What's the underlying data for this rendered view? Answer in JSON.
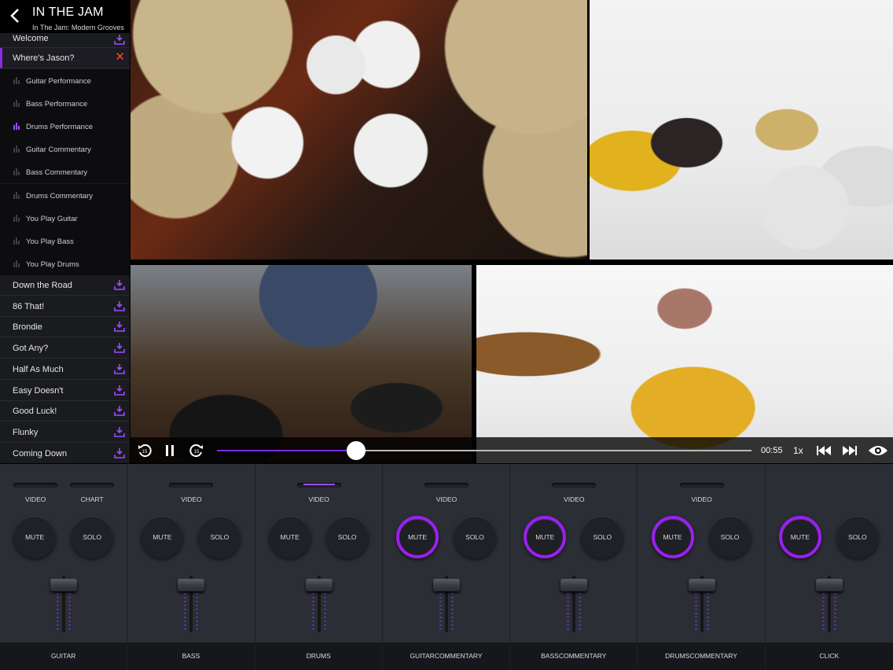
{
  "header": {
    "back_icon": "chevron-left-icon",
    "title": "IN THE JAM",
    "subtitle": "In The Jam: Modern Grooves"
  },
  "sidebar": {
    "top_item": {
      "label": "Welcome",
      "icon": "download-icon"
    },
    "active_song": {
      "label": "Where's Jason?",
      "close_icon": "close-icon"
    },
    "sub_items": [
      {
        "label": "Guitar Performance",
        "playing": false
      },
      {
        "label": "Bass Performance",
        "playing": false
      },
      {
        "label": "Drums Performance",
        "playing": true
      },
      {
        "label": "Guitar Commentary",
        "playing": false
      },
      {
        "label": "Bass Commentary",
        "playing": false
      },
      {
        "label": "Drums Commentary",
        "playing": false
      },
      {
        "label": "You Play Guitar",
        "playing": false
      },
      {
        "label": "You Play Bass",
        "playing": false
      },
      {
        "label": "You Play Drums",
        "playing": false
      }
    ],
    "songs": [
      {
        "label": "Down the Road"
      },
      {
        "label": "86 That!"
      },
      {
        "label": "Brondie"
      },
      {
        "label": "Got Any?"
      },
      {
        "label": "Half As Much"
      },
      {
        "label": "Easy Doesn't"
      },
      {
        "label": "Good Luck!"
      },
      {
        "label": "Flunky"
      },
      {
        "label": "Coming Down"
      }
    ],
    "download_icon": "download-icon",
    "accent": "#8a2be2"
  },
  "transport": {
    "rewind_icon": "rewind-15-icon",
    "pause_icon": "pause-icon",
    "forward_icon": "forward-15-icon",
    "progress": 0.26,
    "time": "00:55",
    "speed": "1x",
    "prev_icon": "skip-previous-icon",
    "next_icon": "skip-next-icon",
    "view_icon": "eye-icon"
  },
  "mixer": {
    "channels": [
      {
        "name_line1": "GUITAR",
        "name_line2": "",
        "toggles": [
          {
            "label": "VIDEO",
            "on": false
          },
          {
            "label": "CHART",
            "on": false
          }
        ],
        "mute": "MUTE",
        "solo": "SOLO",
        "mute_active": false
      },
      {
        "name_line1": "BASS",
        "name_line2": "",
        "toggles": [
          {
            "label": "VIDEO",
            "on": false
          }
        ],
        "mute": "MUTE",
        "solo": "SOLO",
        "mute_active": false
      },
      {
        "name_line1": "DRUMS",
        "name_line2": "",
        "toggles": [
          {
            "label": "VIDEO",
            "on": true
          }
        ],
        "mute": "MUTE",
        "solo": "SOLO",
        "mute_active": false
      },
      {
        "name_line1": "GUITAR",
        "name_line2": "COMMENTARY",
        "toggles": [
          {
            "label": "VIDEO",
            "on": false
          }
        ],
        "mute": "MUTE",
        "solo": "SOLO",
        "mute_active": true
      },
      {
        "name_line1": "BASS",
        "name_line2": "COMMENTARY",
        "toggles": [
          {
            "label": "VIDEO",
            "on": false
          }
        ],
        "mute": "MUTE",
        "solo": "SOLO",
        "mute_active": true
      },
      {
        "name_line1": "DRUMS",
        "name_line2": "COMMENTARY",
        "toggles": [
          {
            "label": "VIDEO",
            "on": false
          }
        ],
        "mute": "MUTE",
        "solo": "SOLO",
        "mute_active": true
      },
      {
        "name_line1": "CLICK",
        "name_line2": "",
        "toggles": [],
        "mute": "MUTE",
        "solo": "SOLO",
        "mute_active": true
      }
    ],
    "active_color": "#9b1ff0"
  }
}
